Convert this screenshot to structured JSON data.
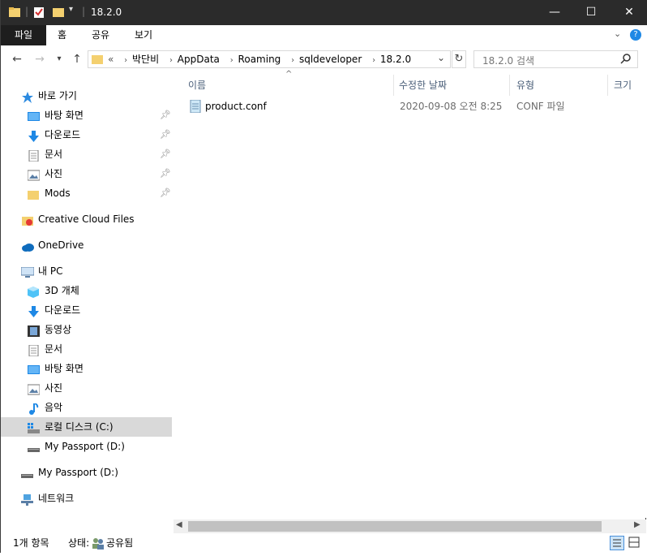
{
  "window": {
    "title": "18.2.0",
    "controls": {
      "minimize": "—",
      "maximize": "☐",
      "close": "✕"
    }
  },
  "ribbon": {
    "tabs": [
      {
        "label": "파일"
      },
      {
        "label": "홈"
      },
      {
        "label": "공유"
      },
      {
        "label": "보기"
      }
    ]
  },
  "address": {
    "prefix": "«",
    "crumbs": [
      "박단비",
      "AppData",
      "Roaming",
      "sqldeveloper",
      "18.2.0"
    ]
  },
  "search": {
    "placeholder": "18.2.0 검색"
  },
  "sidebar": {
    "quick_access": "바로 가기",
    "quick_items": [
      "바탕 화면",
      "다운로드",
      "문서",
      "사진",
      "Mods"
    ],
    "creative_cloud": "Creative Cloud Files",
    "onedrive": "OneDrive",
    "this_pc": "내 PC",
    "pc_items": [
      "3D 개체",
      "다운로드",
      "동영상",
      "문서",
      "바탕 화면",
      "사진",
      "음악",
      "로컬 디스크 (C:)",
      "My Passport (D:)"
    ],
    "passport": "My Passport (D:)",
    "network": "네트워크"
  },
  "columns": {
    "name": "이름",
    "modified": "수정한 날짜",
    "type": "유형",
    "size": "크기"
  },
  "files": [
    {
      "name": "product.conf",
      "modified": "2020-09-08 오전 8:25",
      "type": "CONF 파일"
    }
  ],
  "status": {
    "count": "1개 항목",
    "state_label": "상태:",
    "state_value": "공유됨"
  },
  "colors": {
    "titlebar": "#2b2b2b",
    "selected": "#d9d9d9",
    "accent": "#0078d7"
  }
}
